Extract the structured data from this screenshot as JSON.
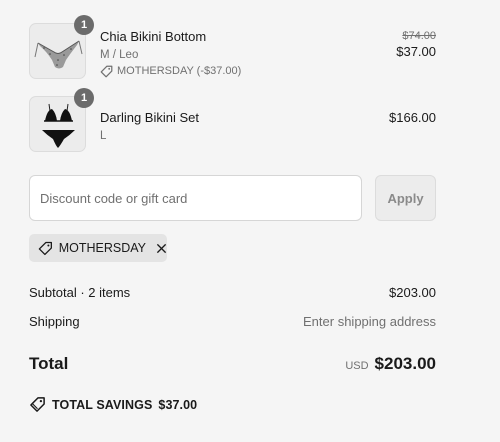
{
  "items": [
    {
      "name": "Chia Bikini Bottom",
      "variant": "M / Leo",
      "discount_label": "MOTHERSDAY (-$37.00)",
      "compare_price": "$74.00",
      "price": "$37.00",
      "quantity": "1",
      "image_icon": "bikini-bottom-thumbnail"
    },
    {
      "name": "Darling Bikini Set",
      "variant": "L",
      "price": "$166.00",
      "quantity": "1",
      "image_icon": "bikini-set-thumbnail"
    }
  ],
  "discount": {
    "placeholder": "Discount code or gift card",
    "apply_label": "Apply",
    "applied_code": "MOTHERSDAY"
  },
  "summary": {
    "subtotal_label": "Subtotal · 2 items",
    "subtotal_value": "$203.00",
    "shipping_label": "Shipping",
    "shipping_value": "Enter shipping address",
    "total_label": "Total",
    "currency": "USD",
    "total_value": "$203.00",
    "savings_label": "TOTAL SAVINGS",
    "savings_value": "$37.00"
  }
}
